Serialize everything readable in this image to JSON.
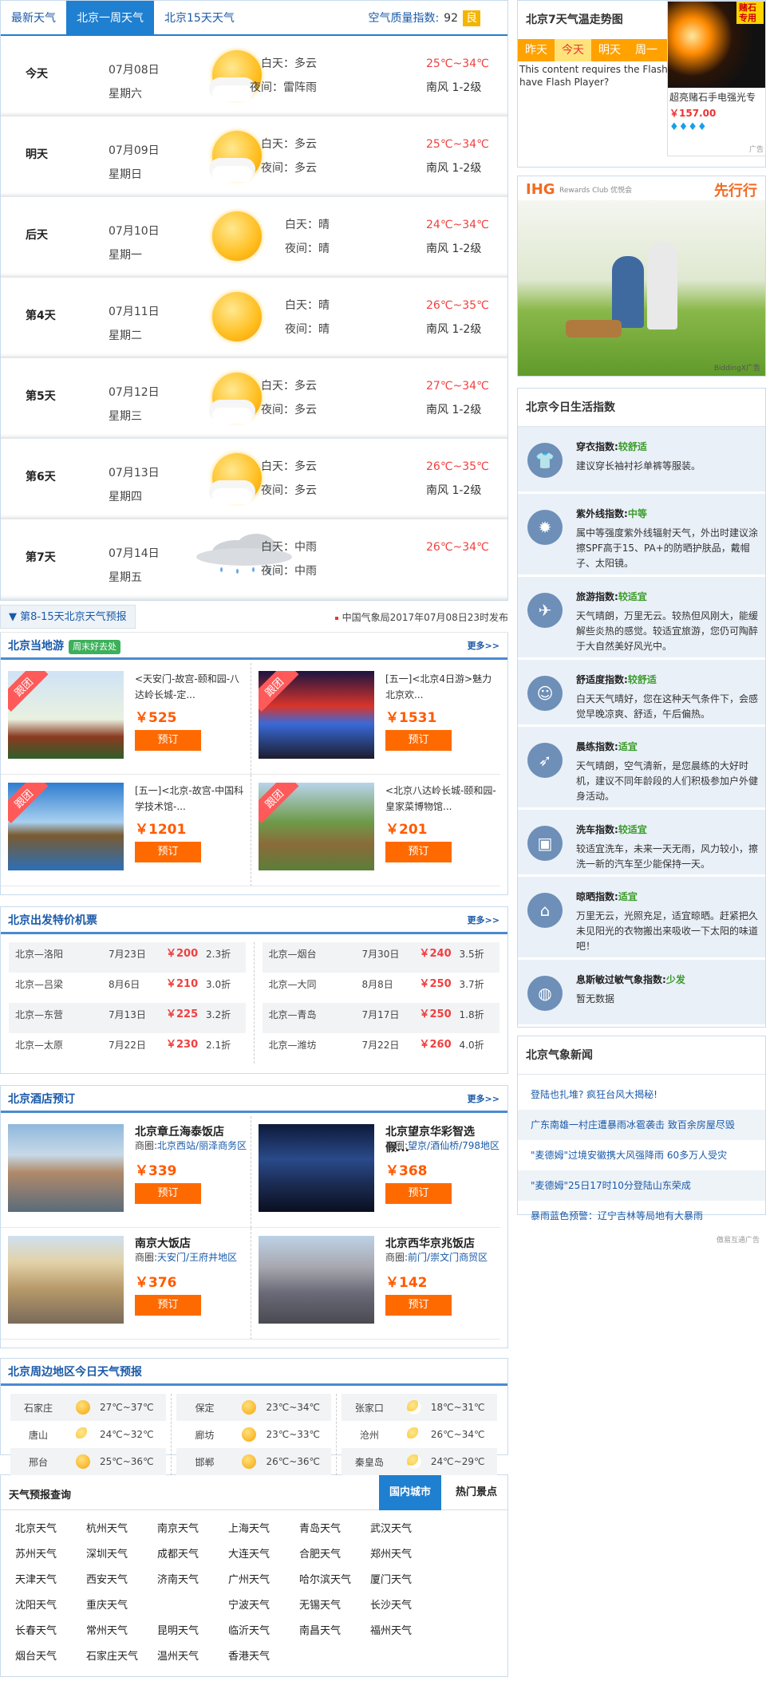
{
  "tabs": [
    "最新天气",
    "北京一周天气",
    "北京15天天气"
  ],
  "aqi": {
    "label": "空气质量指数:",
    "value": "92",
    "level": "良"
  },
  "days": [
    {
      "name": "今天",
      "date": "07月08日",
      "week": "星期六",
      "icon": "partly-cloudy-icon",
      "day": "白天：多云",
      "night": "夜间：雷阵雨",
      "temp": "25℃~34℃",
      "wind": "南风 1-2级"
    },
    {
      "name": "明天",
      "date": "07月09日",
      "week": "星期日",
      "icon": "partly-cloudy-icon",
      "day": "白天：多云",
      "night": "夜间：多云",
      "temp": "25℃~34℃",
      "wind": "南风 1-2级"
    },
    {
      "name": "后天",
      "date": "07月10日",
      "week": "星期一",
      "icon": "sunny-icon",
      "day": "白天：晴",
      "night": "夜间：晴",
      "temp": "24℃~34℃",
      "wind": "南风 1-2级"
    },
    {
      "name": "第4天",
      "date": "07月11日",
      "week": "星期二",
      "icon": "sunny-icon",
      "day": "白天：晴",
      "night": "夜间：晴",
      "temp": "26℃~35℃",
      "wind": "南风 1-2级"
    },
    {
      "name": "第5天",
      "date": "07月12日",
      "week": "星期三",
      "icon": "partly-cloudy-icon",
      "day": "白天：多云",
      "night": "夜间：多云",
      "temp": "27℃~34℃",
      "wind": "南风 1-2级"
    },
    {
      "name": "第6天",
      "date": "07月13日",
      "week": "星期四",
      "icon": "partly-cloudy-icon",
      "day": "白天：多云",
      "night": "夜间：多云",
      "temp": "26℃~35℃",
      "wind": "南风 1-2级"
    },
    {
      "name": "第7天",
      "date": "07月14日",
      "week": "星期五",
      "icon": "rain-icon",
      "day": "白天：中雨",
      "night": "夜间：中雨",
      "temp": "26℃~34℃",
      "wind": ""
    }
  ],
  "strip": {
    "link": "第8-15天北京天气预报",
    "source": "中国气象局2017年07月08日23时发布"
  },
  "tours": {
    "title": "北京当地游",
    "tag": "周末好去处",
    "more": "更多>>",
    "items": [
      {
        "ribbon": "跟团",
        "title": "<天安门-故宫-颐和园-八达岭长城-定...",
        "price": "￥525",
        "btn": "预订"
      },
      {
        "ribbon": "跟团",
        "title": "[五一]<北京4日游>魅力北京欢...",
        "price": "￥1531",
        "btn": "预订"
      },
      {
        "ribbon": "跟团",
        "title": "[五一]<北京-故宫-中国科学技术馆-...",
        "price": "￥1201",
        "btn": "预订"
      },
      {
        "ribbon": "跟团",
        "title": "<北京八达岭长城-颐和园-皇家菜博物馆...",
        "price": "￥201",
        "btn": "预订"
      }
    ]
  },
  "flights": {
    "title": "北京出发特价机票",
    "more": "更多>>",
    "left": [
      {
        "route": "北京—洛阳",
        "date": "7月23日",
        "price": "￥200",
        "disc": "2.3折"
      },
      {
        "route": "北京—吕梁",
        "date": "8月6日",
        "price": "￥210",
        "disc": "3.0折"
      },
      {
        "route": "北京—东营",
        "date": "7月13日",
        "price": "￥225",
        "disc": "3.2折"
      },
      {
        "route": "北京—太原",
        "date": "7月22日",
        "price": "￥230",
        "disc": "2.1折"
      }
    ],
    "right": [
      {
        "route": "北京—烟台",
        "date": "7月30日",
        "price": "￥240",
        "disc": "3.5折"
      },
      {
        "route": "北京—大同",
        "date": "8月8日",
        "price": "￥250",
        "disc": "3.7折"
      },
      {
        "route": "北京—青岛",
        "date": "7月17日",
        "price": "￥250",
        "disc": "1.8折"
      },
      {
        "route": "北京—潍坊",
        "date": "7月22日",
        "price": "￥260",
        "disc": "4.0折"
      }
    ]
  },
  "hotels": {
    "title": "北京酒店预订",
    "more": "更多>>",
    "area_label": "商圈:",
    "items": [
      {
        "name": "北京章丘海泰饭店",
        "area": "北京西站/丽泽商务区",
        "price": "￥339",
        "btn": "预订"
      },
      {
        "name": "北京望京华彩智选假...",
        "area": "望京/酒仙桥/798地区",
        "price": "￥368",
        "btn": "预订"
      },
      {
        "name": "南京大饭店",
        "area": "天安门/王府井地区",
        "price": "￥376",
        "btn": "预订"
      },
      {
        "name": "北京西华京兆饭店",
        "area": "前门/崇文门商贸区",
        "price": "￥142",
        "btn": "预订"
      }
    ]
  },
  "surround": {
    "title": "北京周边地区今日天气预报",
    "cols": [
      [
        {
          "city": "石家庄",
          "temp": "27℃~37℃",
          "icon": "sunny-icon"
        },
        {
          "city": "唐山",
          "temp": "24℃~32℃",
          "icon": "partly-cloudy-icon"
        },
        {
          "city": "邢台",
          "temp": "25℃~36℃",
          "icon": "sunny-icon"
        }
      ],
      [
        {
          "city": "保定",
          "temp": "23℃~34℃",
          "icon": "sunny-icon"
        },
        {
          "city": "廊坊",
          "temp": "23℃~33℃",
          "icon": "sunny-icon"
        },
        {
          "city": "邯郸",
          "temp": "26℃~36℃",
          "icon": "sunny-icon"
        }
      ],
      [
        {
          "city": "张家口",
          "temp": "18℃~31℃",
          "icon": "partly-cloudy-icon"
        },
        {
          "city": "沧州",
          "temp": "26℃~34℃",
          "icon": "partly-cloudy-icon"
        },
        {
          "city": "秦皇岛",
          "temp": "24℃~29℃",
          "icon": "partly-cloudy-icon"
        }
      ]
    ]
  },
  "query": {
    "title": "天气预报查询",
    "tab_on": "国内城市",
    "tab_off": "热门景点",
    "cities": [
      "北京天气",
      "杭州天气",
      "南京天气",
      "上海天气",
      "青岛天气",
      "武汉天气",
      "苏州天气",
      "深圳天气",
      "成都天气",
      "大连天气",
      "合肥天气",
      "郑州天气",
      "天津天气",
      "西安天气",
      "济南天气",
      "广州天气",
      "哈尔滨天气",
      "厦门天气",
      "沈阳天气",
      "重庆天气",
      "",
      "宁波天气",
      "无锡天气",
      "长沙天气",
      "长春天气",
      "常州天气",
      "昆明天气",
      "临沂天气",
      "南昌天气",
      "福州天气",
      "烟台天气",
      "石家庄天气",
      "温州天气",
      "香港天气",
      ""
    ]
  },
  "side": {
    "trend_title": "北京7天气温走势图",
    "trend_tabs": [
      "昨天",
      "今天",
      "明天",
      "周一"
    ],
    "flash": "This content requires the Flash Player. Already have Flash Player?",
    "ad": {
      "badge": "赌石专用",
      "name": "超亮赌石手电强光专",
      "price": "￥157.00",
      "mark": "广告"
    },
    "ihg": {
      "brand": "IHG",
      "club": "Rewards Club 优悦会",
      "slogan": "先行行",
      "mark": "BiddingX广告"
    },
    "life_title": "北京今日生活指数",
    "life": [
      {
        "icon": "shirt-icon",
        "name": "穿衣指数:",
        "level": "较舒适",
        "desc": "建议穿长袖衬衫单裤等服装。"
      },
      {
        "icon": "uv-icon",
        "name": "紫外线指数:",
        "level": "中等",
        "desc": "属中等强度紫外线辐射天气，外出时建议涂擦SPF高于15、PA+的防晒护肤品，戴帽子、太阳镜。"
      },
      {
        "icon": "plane-icon",
        "name": "旅游指数:",
        "level": "较适宜",
        "desc": "天气晴朗，万里无云。较热但风刚大，能缓解些炎热的感觉。较适宜旅游，您仍可陶醉于大自然美好风光中。"
      },
      {
        "icon": "smile-icon",
        "name": "舒适度指数:",
        "level": "较舒适",
        "desc": "白天天气晴好，您在这种天气条件下，会感觉早晚凉爽、舒适，午后偏热。"
      },
      {
        "icon": "run-icon",
        "name": "晨练指数:",
        "level": "适宜",
        "desc": "天气晴朗，空气清新，是您晨练的大好时机，建议不同年龄段的人们积极参加户外健身活动。"
      },
      {
        "icon": "car-icon",
        "name": "洗车指数:",
        "level": "较适宜",
        "desc": "较适宜洗车，未来一天无雨，风力较小，擦洗一新的汽车至少能保持一天。"
      },
      {
        "icon": "dry-icon",
        "name": "晾晒指数:",
        "level": "适宜",
        "desc": "万里无云，光照充足，适宜晾晒。赶紧把久未见阳光的衣物搬出来吸收一下太阳的味道吧！"
      },
      {
        "icon": "mask-icon",
        "name": "息斯敏过敏气象指数:",
        "level": "少发",
        "desc": "暂无数据"
      }
    ],
    "news_title": "北京气象新闻",
    "news": [
      "登陆也扎堆? 疯狂台风大揭秘!",
      "广东南雄一村庄遭暴雨冰雹袭击 致百余房屋尽毁",
      "\"麦德姆\"过境安徽携大风强降雨 60多万人受灾",
      "\"麦德姆\"25日17时10分登陆山东荣成",
      "暴雨蓝色预警：辽宁吉林等局地有大暴雨"
    ],
    "bottom_mark": "傲易互通广告"
  }
}
